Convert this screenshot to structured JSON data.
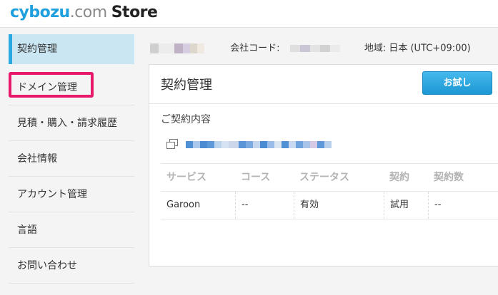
{
  "logo": {
    "part1": "cybozu",
    "part2": ".com",
    "part3": "Store"
  },
  "sidebar": {
    "items": [
      {
        "label": "契約管理"
      },
      {
        "label": "ドメイン管理"
      },
      {
        "label": "見積・購入・請求履歴"
      },
      {
        "label": "会社情報"
      },
      {
        "label": "アカウント管理"
      },
      {
        "label": "言語"
      },
      {
        "label": "お問い合わせ"
      }
    ]
  },
  "infobar": {
    "company_code_label": "会社コード:",
    "region_label": "地域: 日本 (UTC+09:00)"
  },
  "panel": {
    "title": "契約管理",
    "trial_button": "お試し",
    "section_title": "ご契約内容"
  },
  "table": {
    "headers": [
      "サービス",
      "コース",
      "ステータス",
      "契約",
      "契約数"
    ],
    "rows": [
      [
        "Garoon",
        "--",
        "有効",
        "試用",
        "--"
      ]
    ]
  },
  "colors": {
    "accent": "#2aa8e0",
    "highlight": "#e8186a",
    "button": "#1c97d4"
  }
}
